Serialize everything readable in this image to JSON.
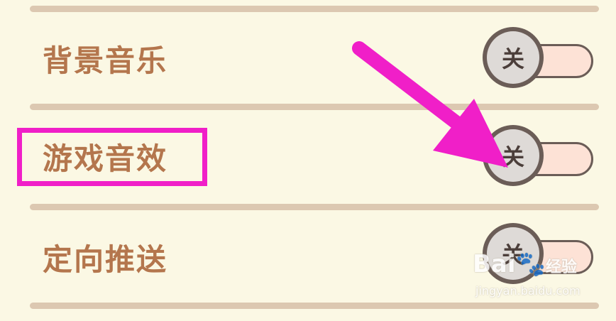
{
  "settings": {
    "rows": [
      {
        "label": "背景音乐",
        "toggle_text": "关",
        "state": "off"
      },
      {
        "label": "游戏音效",
        "toggle_text": "关",
        "state": "off"
      },
      {
        "label": "定向推送",
        "toggle_text": "关",
        "state": "off"
      }
    ]
  },
  "watermark": {
    "brand": "Bai",
    "brand_suffix": "经验",
    "url": "jingyan.baidu.com"
  },
  "colors": {
    "background": "#fbf8e4",
    "label": "#b4764d",
    "divider": "#dcc8b1",
    "toggle_track": "#fde2d6",
    "annotation": "#f01fc8"
  }
}
